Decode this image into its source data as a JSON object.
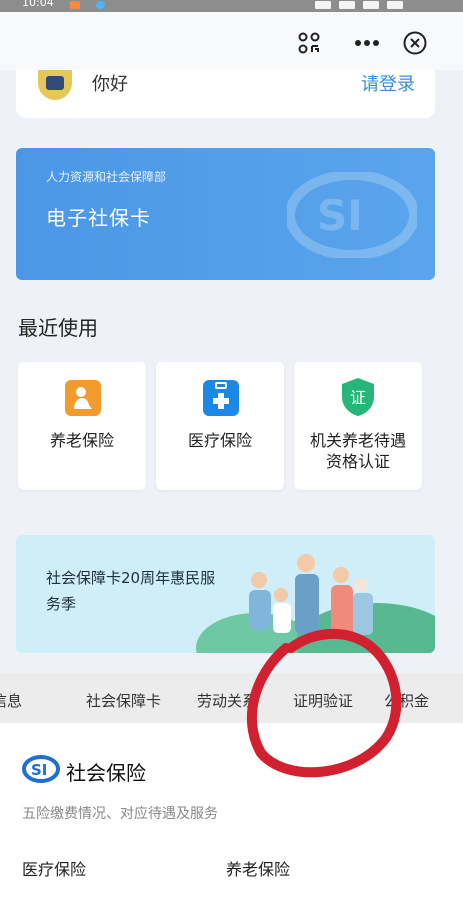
{
  "status_bar": {
    "time": "10:04"
  },
  "greeting": {
    "text": "你好",
    "login": "请登录"
  },
  "social_card": {
    "org": "人力资源和社会保障部",
    "title": "电子社保卡"
  },
  "recent": {
    "title": "最近使用",
    "items": [
      {
        "label": "养老保险",
        "icon": "pension-icon"
      },
      {
        "label": "医疗保险",
        "icon": "medical-kit-icon"
      },
      {
        "label": "机关养老待遇\n资格认证",
        "icon": "certificate-shield-icon"
      }
    ],
    "cert_badge": "证"
  },
  "banner": {
    "text": "社会保障卡20周年惠民服务季"
  },
  "tabs": [
    "信息",
    "社会保障卡",
    "劳动关系",
    "证明验证",
    "公积金"
  ],
  "insurance": {
    "title": "社会保险",
    "subtitle": "五险缴费情况、对应待遇及服务",
    "links": [
      "医疗保险",
      "养老保险"
    ]
  },
  "colors": {
    "accent": "#3a8be0",
    "card_blue": "#4b97e6",
    "annotation_red": "#d1202f"
  }
}
